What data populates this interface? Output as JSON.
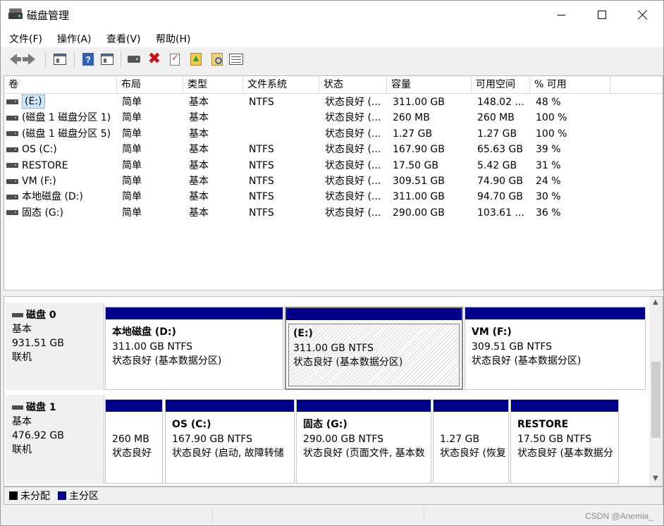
{
  "window": {
    "title": "磁盘管理",
    "watermark": "CSDN @Anemia_"
  },
  "menu": [
    "文件(F)",
    "操作(A)",
    "查看(V)",
    "帮助(H)"
  ],
  "columns": [
    "卷",
    "布局",
    "类型",
    "文件系统",
    "状态",
    "容量",
    "可用空间",
    "% 可用"
  ],
  "volumes": [
    {
      "name": "(E:)",
      "layout": "简单",
      "type": "基本",
      "fs": "NTFS",
      "status": "状态良好 (...",
      "capacity": "311.00 GB",
      "free": "148.02 ...",
      "pct": "48 %",
      "selected": true
    },
    {
      "name": "(磁盘 1 磁盘分区 1)",
      "layout": "简单",
      "type": "基本",
      "fs": "",
      "status": "状态良好 (...",
      "capacity": "260 MB",
      "free": "260 MB",
      "pct": "100 %"
    },
    {
      "name": "(磁盘 1 磁盘分区 5)",
      "layout": "简单",
      "type": "基本",
      "fs": "",
      "status": "状态良好 (...",
      "capacity": "1.27 GB",
      "free": "1.27 GB",
      "pct": "100 %"
    },
    {
      "name": "OS (C:)",
      "layout": "简单",
      "type": "基本",
      "fs": "NTFS",
      "status": "状态良好 (...",
      "capacity": "167.90 GB",
      "free": "65.63 GB",
      "pct": "39 %"
    },
    {
      "name": "RESTORE",
      "layout": "简单",
      "type": "基本",
      "fs": "NTFS",
      "status": "状态良好 (...",
      "capacity": "17.50 GB",
      "free": "5.42 GB",
      "pct": "31 %"
    },
    {
      "name": "VM (F:)",
      "layout": "简单",
      "type": "基本",
      "fs": "NTFS",
      "status": "状态良好 (...",
      "capacity": "309.51 GB",
      "free": "74.90 GB",
      "pct": "24 %"
    },
    {
      "name": "本地磁盘 (D:)",
      "layout": "简单",
      "type": "基本",
      "fs": "NTFS",
      "status": "状态良好 (...",
      "capacity": "311.00 GB",
      "free": "94.70 GB",
      "pct": "30 %"
    },
    {
      "name": "固态 (G:)",
      "layout": "简单",
      "type": "基本",
      "fs": "NTFS",
      "status": "状态良好 (...",
      "capacity": "290.00 GB",
      "free": "103.61 ...",
      "pct": "36 %"
    }
  ],
  "disks": [
    {
      "title": "磁盘 0",
      "kind": "基本",
      "size": "931.51 GB",
      "state": "联机",
      "partitions": [
        {
          "name": "本地磁盘  (D:)",
          "line1": "311.00 GB NTFS",
          "line2": "状态良好 (基本数据分区)"
        },
        {
          "name": "(E:)",
          "line1": "311.00 GB NTFS",
          "line2": "状态良好 (基本数据分区)",
          "selected": true
        },
        {
          "name": "VM  (F:)",
          "line1": "309.51 GB NTFS",
          "line2": "状态良好 (基本数据分区)"
        }
      ]
    },
    {
      "title": "磁盘 1",
      "kind": "基本",
      "size": "476.92 GB",
      "state": "联机",
      "partitions": [
        {
          "name": "",
          "line1": "260 MB",
          "line2": "状态良好"
        },
        {
          "name": "OS  (C:)",
          "line1": "167.90 GB NTFS",
          "line2": "状态良好 (启动, 故障转储"
        },
        {
          "name": "固态  (G:)",
          "line1": "290.00 GB NTFS",
          "line2": "状态良好 (页面文件, 基本数"
        },
        {
          "name": "",
          "line1": "1.27 GB",
          "line2": "状态良好 (恢复"
        },
        {
          "name": "RESTORE",
          "line1": "17.50 GB NTFS",
          "line2": "状态良好 (基本数据分"
        }
      ]
    }
  ],
  "legend": {
    "unallocated": {
      "label": "未分配",
      "color": "#000000"
    },
    "primary": {
      "label": "主分区",
      "color": "#00008b"
    }
  },
  "toolbar_icons": [
    "back-icon",
    "forward-icon",
    "console-tree-icon",
    "help-icon",
    "show-pane-icon",
    "connect-drive-icon",
    "delete-icon",
    "check-icon",
    "folder-up-icon",
    "folder-search-icon",
    "properties-icon"
  ]
}
